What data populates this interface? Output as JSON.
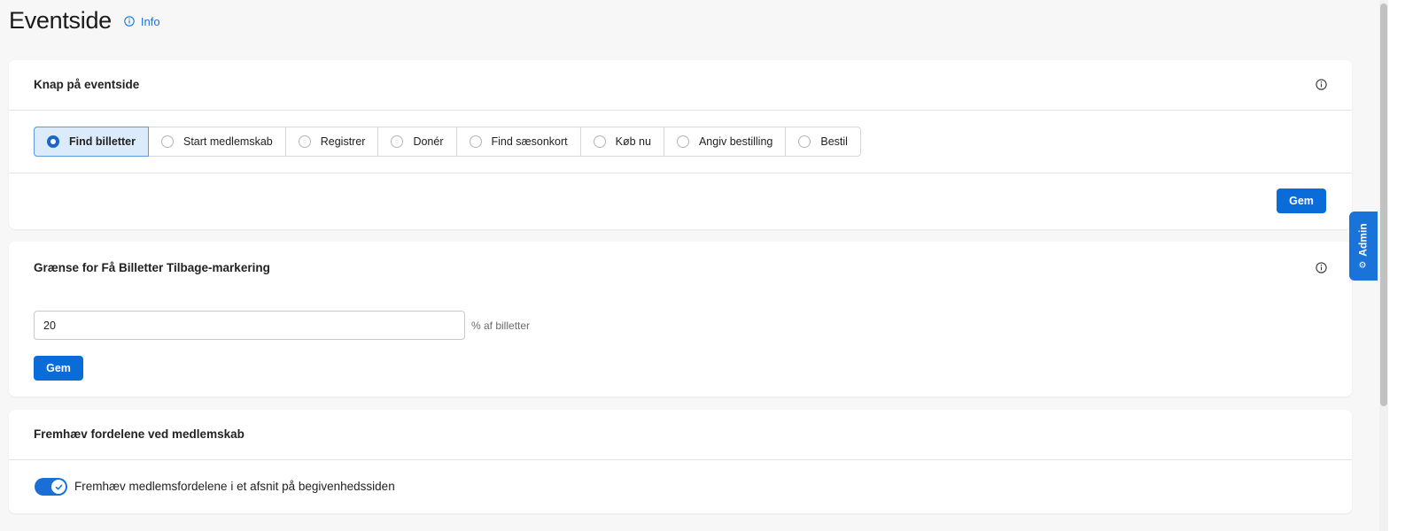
{
  "header": {
    "title": "Eventside",
    "info_label": "Info"
  },
  "button_card": {
    "title": "Knap på eventside",
    "options": [
      {
        "label": "Find billetter",
        "selected": true
      },
      {
        "label": "Start medlemskab",
        "selected": false
      },
      {
        "label": "Registrer",
        "selected": false
      },
      {
        "label": "Donér",
        "selected": false
      },
      {
        "label": "Find sæsonkort",
        "selected": false
      },
      {
        "label": "Køb nu",
        "selected": false
      },
      {
        "label": "Angiv bestilling",
        "selected": false
      },
      {
        "label": "Bestil",
        "selected": false
      }
    ],
    "save_label": "Gem"
  },
  "limit_card": {
    "title": "Grænse for Få Billetter Tilbage-markering",
    "value": "20",
    "suffix": "% af billetter",
    "save_label": "Gem"
  },
  "membership_card": {
    "title": "Fremhæv fordelene ved medlemskab",
    "toggle_label": "Fremhæv medlemsfordelene i et afsnit på begivenhedssiden",
    "toggle_on": true
  },
  "admin_tab": {
    "label": "Admin"
  },
  "colors": {
    "accent": "#0a6cd8",
    "selected_bg": "#dcebfb"
  }
}
